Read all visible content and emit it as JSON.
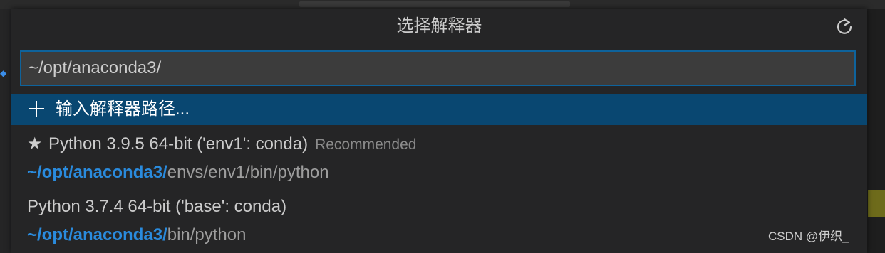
{
  "picker": {
    "title": "选择解释器",
    "refresh_icon": "refresh-icon",
    "search": {
      "value": "~/opt/anaconda3/",
      "placeholder": ""
    },
    "enter_path": {
      "icon": "plus-icon",
      "label": "输入解释器路径..."
    },
    "items": [
      {
        "starred": true,
        "name": "Python 3.9.5 64-bit ('env1': conda)",
        "badge": "Recommended",
        "path_match": "~/opt/anaconda3/",
        "path_rest": "envs/env1/bin/python"
      },
      {
        "starred": false,
        "name": "Python 3.7.4 64-bit ('base': conda)",
        "badge": "",
        "path_match": "~/opt/anaconda3/",
        "path_rest": "bin/python"
      }
    ]
  },
  "watermark": "CSDN @伊织_",
  "colors": {
    "background": "#252526",
    "selected_row": "#094771",
    "input_border": "#0e639c",
    "match_highlight": "#2a8bdd",
    "text": "#cccccc",
    "muted": "#8b8b8b"
  }
}
